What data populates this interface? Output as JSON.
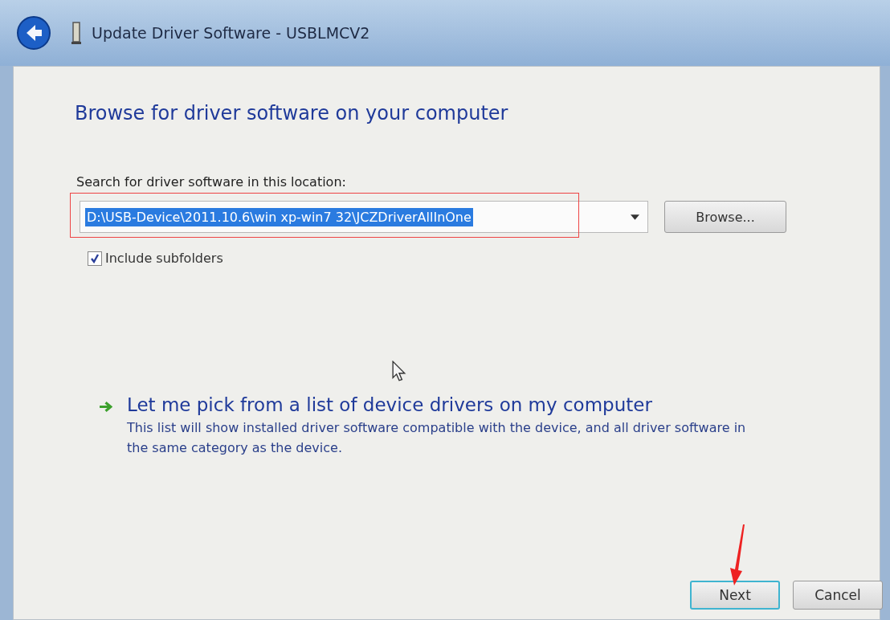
{
  "window": {
    "title": "Update Driver Software - USBLMCV2"
  },
  "heading": "Browse for driver software on your computer",
  "location": {
    "label": "Search for driver software in this location:",
    "value": "D:\\USB-Device\\2011.10.6\\win xp-win7 32\\JCZDriverAllInOne",
    "selected": true
  },
  "browse_button": "Browse...",
  "include_subfolders": {
    "label": "Include subfolders",
    "checked": true
  },
  "option": {
    "title": "Let me pick from a list of device drivers on my computer",
    "description": "This list will show installed driver software compatible with the device, and all driver software in the same category as the device."
  },
  "buttons": [
    {
      "label": "Next",
      "default": true
    },
    {
      "label": "Cancel",
      "default": false
    }
  ]
}
